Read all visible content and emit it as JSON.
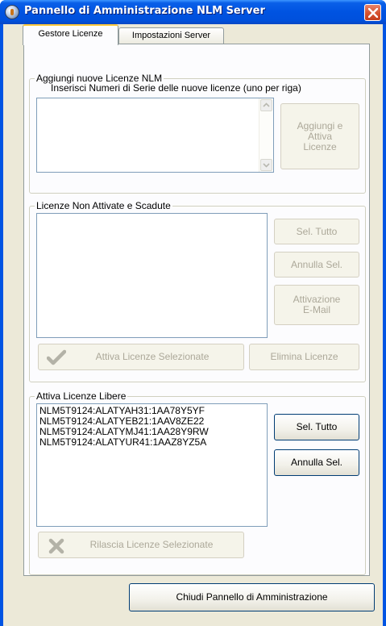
{
  "window": {
    "title": "Pannello di Amministrazione NLM Server"
  },
  "tabs": [
    {
      "label": "Gestore Licenze",
      "active": true
    },
    {
      "label": "Impostazioni Server",
      "active": false
    }
  ],
  "add_group": {
    "title": "Aggiungi nuove Licenze NLM",
    "instructions": "Inserisci Numeri di Serie delle nuove licenze (uno per riga)",
    "serials_value": "",
    "add_button": "Aggiungi e\nAttiva\nLicenze"
  },
  "inactive_group": {
    "title": "Licenze Non Attivate e Scadute",
    "items": [],
    "select_all": "Sel. Tutto",
    "deselect": "Annulla Sel.",
    "email_activation": "Attivazione\nE-Mail",
    "activate_selected": "Attiva Licenze Selezionate",
    "delete": "Elimina Licenze"
  },
  "free_group": {
    "title": "Attiva Licenze Libere",
    "items": [
      "NLM5T9124:ALATYAH31:1AA78Y5YF",
      "NLM5T9124:ALATYEB21:1AAV8ZE22",
      "NLM5T9124:ALATYMJ41:1AA28Y9RW",
      "NLM5T9124:ALATYUR41:1AAZ8YZ5A"
    ],
    "select_all": "Sel. Tutto",
    "deselect": "Annulla Sel.",
    "release_selected": "Rilascia Licenze Selezionate"
  },
  "footer": {
    "close_button": "Chiudi Pannello di Amministrazione"
  },
  "icons": {
    "title": "nlm-server-icon",
    "close": "close-icon",
    "activate": "checkmark-icon",
    "release": "cross-icon"
  },
  "colors": {
    "titlebar": "#0054e3",
    "close_button": "#d5512e",
    "dialog_bg": "#ece9d8",
    "tab_accent": "#ffc83c",
    "disabled_text": "#aca899"
  }
}
